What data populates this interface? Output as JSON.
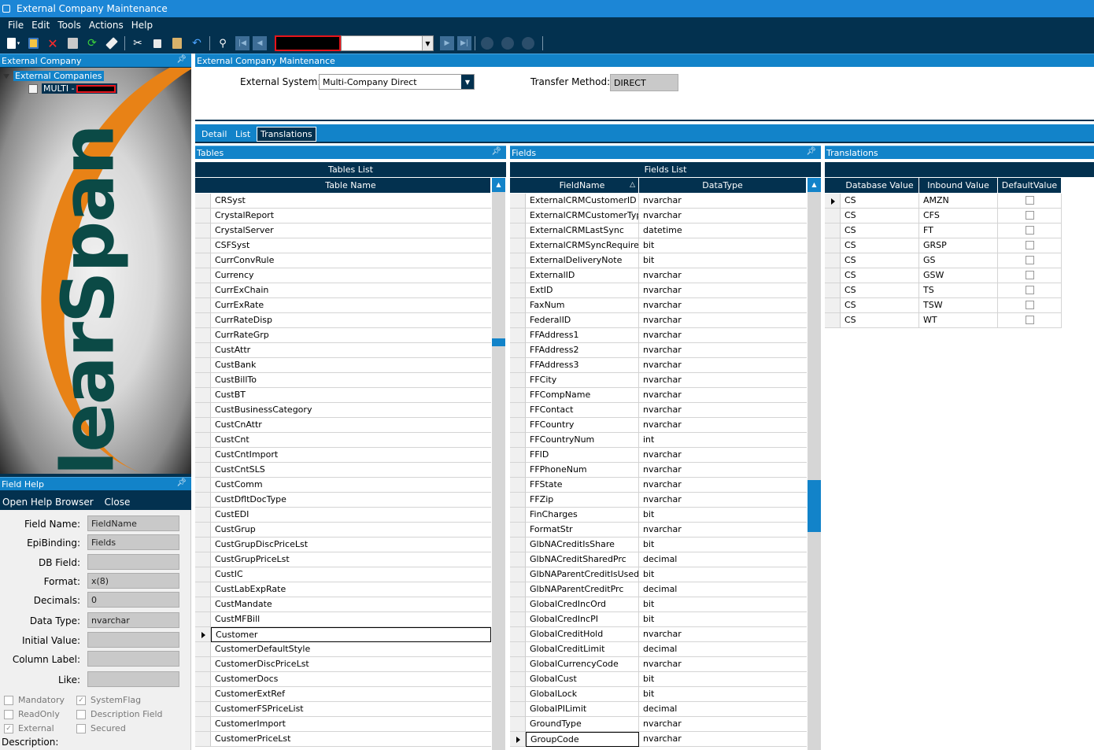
{
  "window": {
    "title": "External Company Maintenance"
  },
  "menu": [
    "File",
    "Edit",
    "Tools",
    "Actions",
    "Help"
  ],
  "toolbar": {
    "icons": [
      "new-icon",
      "save-icon",
      "delete-icon",
      "attach-icon",
      "refresh-icon",
      "clear-icon",
      "cut-icon",
      "copy-icon",
      "paste-icon",
      "undo-icon",
      "search-icon"
    ],
    "nav_icons": [
      "first-record-icon",
      "previous-record-icon",
      "next-record-icon",
      "last-record-icon"
    ]
  },
  "left_panel": {
    "title": "External Company",
    "tree_root": "External Companies",
    "tree_child": "MULTI -",
    "logo_text": "ClearSpan"
  },
  "field_help": {
    "title": "Field Help",
    "actions": [
      "Open Help Browser",
      "Close"
    ],
    "rows": [
      {
        "label": "Field Name:",
        "value": "FieldName"
      },
      {
        "label": "EpiBinding:",
        "value": "Fields"
      },
      {
        "label": "DB Field:",
        "value": ""
      },
      {
        "label": "Format:",
        "value": "x(8)"
      },
      {
        "label": "Decimals:",
        "value": "0"
      },
      {
        "label": "Data Type:",
        "value": "nvarchar"
      },
      {
        "label": "Initial Value:",
        "value": ""
      },
      {
        "label": "Column Label:",
        "value": ""
      },
      {
        "label": "Like:",
        "value": ""
      }
    ],
    "checks_left": [
      {
        "label": "Mandatory",
        "checked": false
      },
      {
        "label": "ReadOnly",
        "checked": false
      },
      {
        "label": "External",
        "checked": true
      }
    ],
    "checks_right": [
      {
        "label": "SystemFlag",
        "checked": true
      },
      {
        "label": "Description Field",
        "checked": false
      },
      {
        "label": "Secured",
        "checked": false
      }
    ],
    "description_label": "Description:"
  },
  "main": {
    "title": "External Company Maintenance",
    "external_system_label": "External System:",
    "external_system_value": "Multi-Company Direct",
    "transfer_method_label": "Transfer Method:",
    "transfer_method_value": "DIRECT",
    "tabs": [
      "Detail",
      "List",
      "Translations"
    ],
    "active_tab": "Translations"
  },
  "tables_panel": {
    "title": "Tables",
    "caption": "Tables List",
    "column": "Table Name",
    "selected": "Customer",
    "rows": [
      "CRSyst",
      "CrystalReport",
      "CrystalServer",
      "CSFSyst",
      "CurrConvRule",
      "Currency",
      "CurrExChain",
      "CurrExRate",
      "CurrRateDisp",
      "CurrRateGrp",
      "CustAttr",
      "CustBank",
      "CustBillTo",
      "CustBT",
      "CustBusinessCategory",
      "CustCnAttr",
      "CustCnt",
      "CustCntImport",
      "CustCntSLS",
      "CustComm",
      "CustDfltDocType",
      "CustEDI",
      "CustGrup",
      "CustGrupDiscPriceLst",
      "CustGrupPriceLst",
      "CustIC",
      "CustLabExpRate",
      "CustMandate",
      "CustMFBill",
      "Customer",
      "CustomerDefaultStyle",
      "CustomerDiscPriceLst",
      "CustomerDocs",
      "CustomerExtRef",
      "CustomerFSPriceList",
      "CustomerImport",
      "CustomerPriceLst"
    ]
  },
  "fields_panel": {
    "title": "Fields",
    "caption": "Fields List",
    "columns": [
      "FieldName",
      "DataType"
    ],
    "selected": "GroupCode",
    "rows": [
      [
        "ExternalCRMCustomerID",
        "nvarchar"
      ],
      [
        "ExternalCRMCustomerTyp",
        "nvarchar"
      ],
      [
        "ExternalCRMLastSync",
        "datetime"
      ],
      [
        "ExternalCRMSyncRequire",
        "bit"
      ],
      [
        "ExternalDeliveryNote",
        "bit"
      ],
      [
        "ExternalID",
        "nvarchar"
      ],
      [
        "ExtID",
        "nvarchar"
      ],
      [
        "FaxNum",
        "nvarchar"
      ],
      [
        "FederalID",
        "nvarchar"
      ],
      [
        "FFAddress1",
        "nvarchar"
      ],
      [
        "FFAddress2",
        "nvarchar"
      ],
      [
        "FFAddress3",
        "nvarchar"
      ],
      [
        "FFCity",
        "nvarchar"
      ],
      [
        "FFCompName",
        "nvarchar"
      ],
      [
        "FFContact",
        "nvarchar"
      ],
      [
        "FFCountry",
        "nvarchar"
      ],
      [
        "FFCountryNum",
        "int"
      ],
      [
        "FFID",
        "nvarchar"
      ],
      [
        "FFPhoneNum",
        "nvarchar"
      ],
      [
        "FFState",
        "nvarchar"
      ],
      [
        "FFZip",
        "nvarchar"
      ],
      [
        "FinCharges",
        "bit"
      ],
      [
        "FormatStr",
        "nvarchar"
      ],
      [
        "GlbNACreditIsShare",
        "bit"
      ],
      [
        "GlbNACreditSharedPrc",
        "decimal"
      ],
      [
        "GlbNAParentCreditIsUsed",
        "bit"
      ],
      [
        "GlbNAParentCreditPrc",
        "decimal"
      ],
      [
        "GlobalCredIncOrd",
        "bit"
      ],
      [
        "GlobalCredIncPI",
        "bit"
      ],
      [
        "GlobalCreditHold",
        "nvarchar"
      ],
      [
        "GlobalCreditLimit",
        "decimal"
      ],
      [
        "GlobalCurrencyCode",
        "nvarchar"
      ],
      [
        "GlobalCust",
        "bit"
      ],
      [
        "GlobalLock",
        "bit"
      ],
      [
        "GlobalPILimit",
        "decimal"
      ],
      [
        "GroundType",
        "nvarchar"
      ],
      [
        "GroupCode",
        "nvarchar"
      ]
    ]
  },
  "translations_panel": {
    "title": "Translations",
    "columns": [
      "Database Value",
      "Inbound Value",
      "DefaultValue"
    ],
    "rows": [
      [
        "CS",
        "AMZN",
        false
      ],
      [
        "CS",
        "CFS",
        false
      ],
      [
        "CS",
        "FT",
        false
      ],
      [
        "CS",
        "GRSP",
        false
      ],
      [
        "CS",
        "GS",
        false
      ],
      [
        "CS",
        "GSW",
        false
      ],
      [
        "CS",
        "TS",
        false
      ],
      [
        "CS",
        "TSW",
        false
      ],
      [
        "CS",
        "WT",
        false
      ]
    ]
  }
}
